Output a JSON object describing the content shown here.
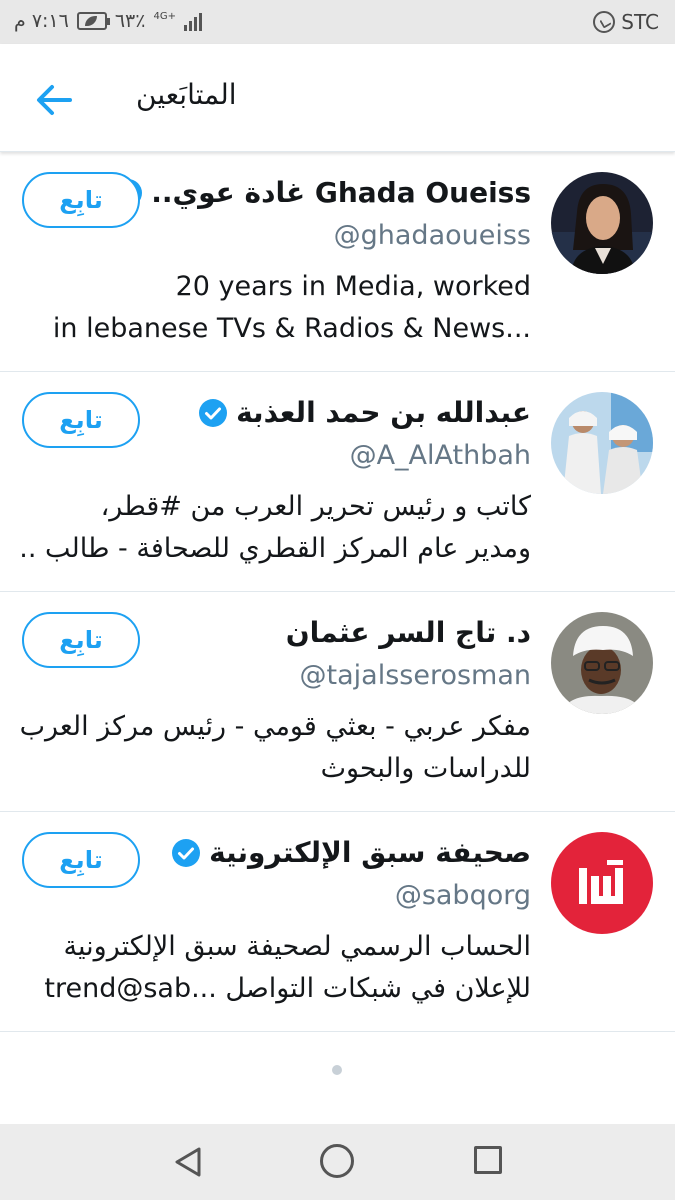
{
  "status_bar": {
    "time": "٧:١٦ م",
    "battery": "٦٣٪",
    "network": "4G+",
    "carrier": "STC"
  },
  "header": {
    "title": "المتابَعين"
  },
  "accent_color": "#1da1f2",
  "followers": [
    {
      "name": "Ghada Oueiss غادة عوي..",
      "handle": "@ghadaoueiss",
      "verified": true,
      "follow_label": "تابِع",
      "bio_lines": [
        "20 years in Media, worked",
        "in lebanese TVs & Radios & News..."
      ]
    },
    {
      "name": "عبدالله بن حمد العذبة",
      "handle": "@A_AlAthbah",
      "verified": true,
      "follow_label": "تابِع",
      "bio_lines": [
        "كاتب و رئيس تحرير العرب من #قطر،",
        "ومدير عام المركز القطري للصحافة - طالب ..."
      ]
    },
    {
      "name": "د. تاج السر عثمان",
      "handle": "@tajalsserosman",
      "verified": false,
      "follow_label": "تابِع",
      "bio_lines": [
        "مفكر عربي - بعثي قومي - رئيس مركز العرب",
        "للدراسات والبحوث"
      ]
    },
    {
      "name": "صحيفة سبق الإلكترونية",
      "handle": "@sabqorg",
      "verified": true,
      "follow_label": "تابِع",
      "bio_lines": [
        "الحساب الرسمي لصحيفة سبق الإلكترونية",
        "للإعلان في شبكات التواصل ...trend@sab"
      ]
    }
  ]
}
